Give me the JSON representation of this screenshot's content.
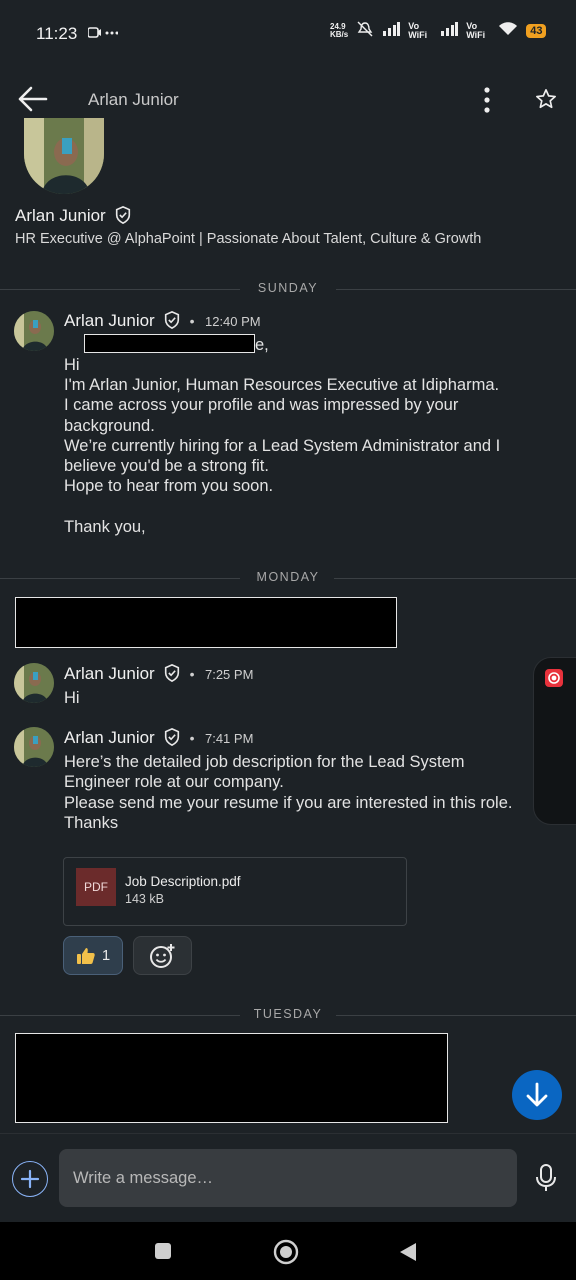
{
  "status_bar": {
    "time": "11:23",
    "data_speed": "24.9\nKB/s",
    "wifi_label": "Vo WiFi",
    "battery": "43"
  },
  "header": {
    "title": "Arlan Junior"
  },
  "profile": {
    "name": "Arlan Junior",
    "headline": "HR Executive @ AlphaPoint | Passionate About Talent, Culture & Growth"
  },
  "dividers": {
    "sunday": "SUNDAY",
    "monday": "MONDAY",
    "tuesday": "TUESDAY"
  },
  "messages": [
    {
      "sender": "Arlan Junior",
      "time": "12:40 PM",
      "greeting": "Hi",
      "greeting_tail": "e,",
      "body": "I'm Arlan Junior, Human Resources Executive at Idipharma.\nI came across your profile and was impressed by your\nbackground.\nWe’re currently hiring for a Lead System Administrator and I\nbelieve you'd be a strong fit.\nHope to hear from you soon.\n\nThank you,"
    },
    {
      "sender": "Arlan Junior",
      "time": "7:25 PM",
      "body": "Hi"
    },
    {
      "sender": "Arlan Junior",
      "time": "7:41 PM",
      "body": "Here’s the detailed job description for the Lead System\nEngineer role at our company.\nPlease send me your resume if you are interested in this role.\nThanks"
    }
  ],
  "attachment": {
    "type_label": "PDF",
    "file_name": "Job Description.pdf",
    "file_size": "143 kB"
  },
  "reactions": {
    "like_count": "1"
  },
  "composer": {
    "placeholder": "Write a message…"
  },
  "colors": {
    "background": "#1d2226",
    "accent": "#0a66c2",
    "battery": "#f0a020"
  }
}
